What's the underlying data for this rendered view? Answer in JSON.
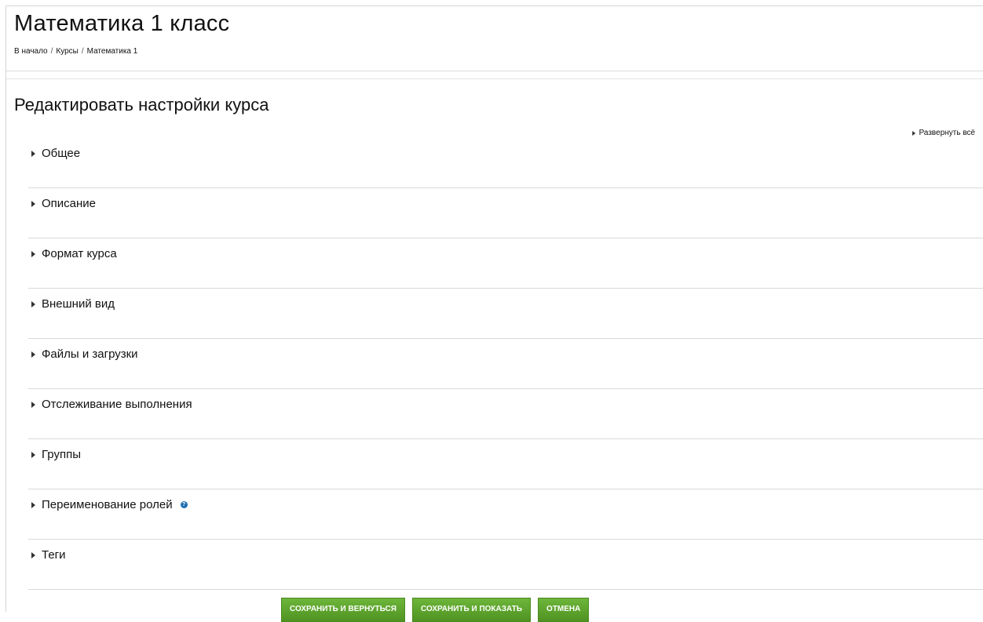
{
  "page": {
    "title": "Математика 1 класс"
  },
  "breadcrumb": {
    "items": [
      "В начало",
      "Курсы",
      "Математика 1"
    ],
    "separator": "/"
  },
  "form": {
    "heading": "Редактировать настройки курса",
    "expand_all_label": "Развернуть всё",
    "sections": [
      {
        "label": "Общее",
        "has_help": false
      },
      {
        "label": "Описание",
        "has_help": false
      },
      {
        "label": "Формат курса",
        "has_help": false
      },
      {
        "label": "Внешний вид",
        "has_help": false
      },
      {
        "label": "Файлы и загрузки",
        "has_help": false
      },
      {
        "label": "Отслеживание выполнения",
        "has_help": false
      },
      {
        "label": "Группы",
        "has_help": false
      },
      {
        "label": "Переименование ролей",
        "has_help": true
      },
      {
        "label": "Теги",
        "has_help": false
      }
    ],
    "help_icon_glyph": "?"
  },
  "buttons": {
    "save_return": "СОХРАНИТЬ И ВЕРНУТЬСЯ",
    "save_display": "СОХРАНИТЬ И ПОКАЗАТЬ",
    "cancel": "ОТМЕНА"
  },
  "colors": {
    "button_green": "#5fa52d",
    "help_icon_blue": "#1f6fb2",
    "divider": "#d9d9d9"
  }
}
